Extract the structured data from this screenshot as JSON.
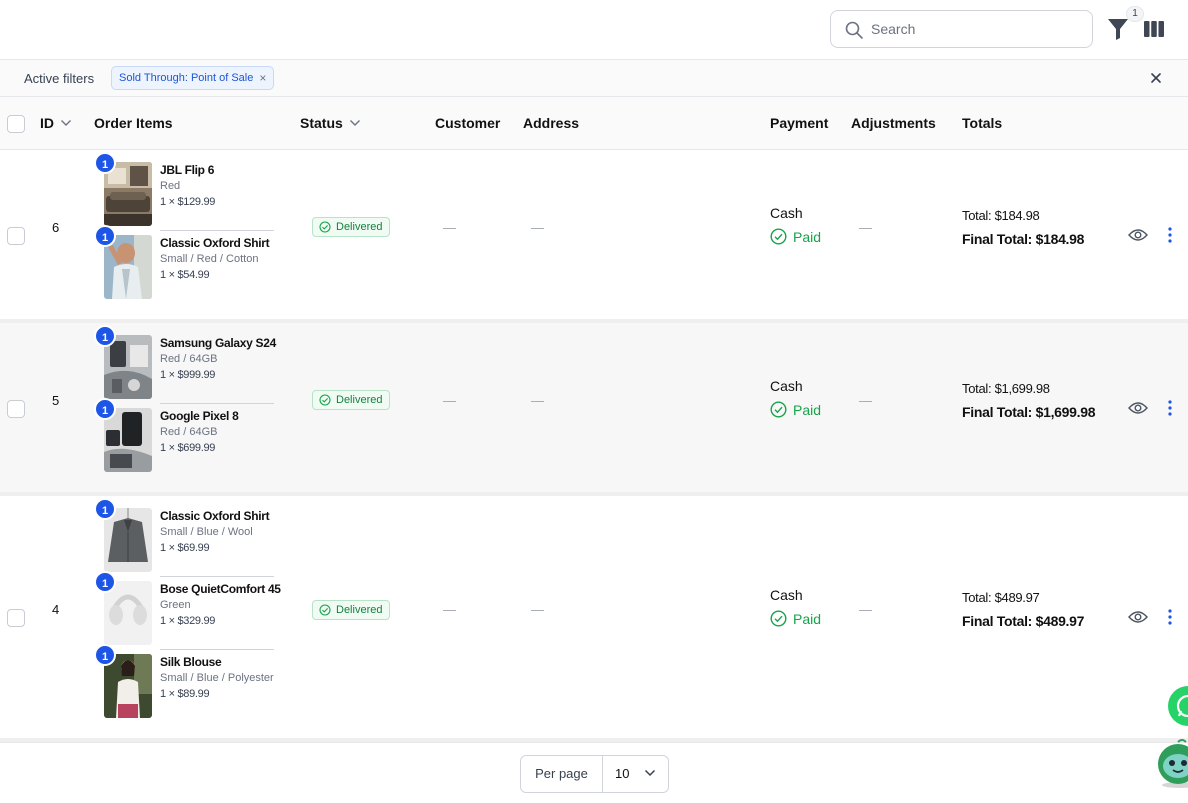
{
  "search": {
    "placeholder": "Search"
  },
  "toolbar": {
    "filter_count": "1"
  },
  "active_filters": {
    "label": "Active filters",
    "chips": [
      {
        "label": "Sold Through: Point of Sale"
      }
    ]
  },
  "columns": {
    "id": "ID",
    "order_items": "Order Items",
    "status": "Status",
    "customer": "Customer",
    "address": "Address",
    "payment": "Payment",
    "adjustments": "Adjustments",
    "totals": "Totals"
  },
  "orders": [
    {
      "id": "6",
      "items": [
        {
          "qty": "1",
          "name": "JBL Flip 6",
          "variant": "Red",
          "price": "1 × $129.99",
          "thumb": "living-room"
        },
        {
          "qty": "1",
          "name": "Classic Oxford Shirt",
          "variant": "Small / Red / Cotton",
          "price": "1 × $54.99",
          "thumb": "shirt-model"
        }
      ],
      "status": "Delivered",
      "customer": "—",
      "address": "—",
      "payment_method": "Cash",
      "payment_status": "Paid",
      "adjustments": "—",
      "total": "Total: $184.98",
      "final_total": "Final Total: $184.98"
    },
    {
      "id": "5",
      "items": [
        {
          "qty": "1",
          "name": "Samsung Galaxy S24",
          "variant": "Red / 64GB",
          "price": "1 × $999.99",
          "thumb": "phone-desk"
        },
        {
          "qty": "1",
          "name": "Google Pixel 8",
          "variant": "Red / 64GB",
          "price": "1 × $699.99",
          "thumb": "phone-dark"
        }
      ],
      "status": "Delivered",
      "customer": "—",
      "address": "—",
      "payment_method": "Cash",
      "payment_status": "Paid",
      "adjustments": "—",
      "total": "Total: $1,699.98",
      "final_total": "Final Total: $1,699.98"
    },
    {
      "id": "4",
      "items": [
        {
          "qty": "1",
          "name": "Classic Oxford Shirt",
          "variant": "Small / Blue / Wool",
          "price": "1 × $69.99",
          "thumb": "jacket"
        },
        {
          "qty": "1",
          "name": "Bose QuietComfort 45",
          "variant": "Green",
          "price": "1 × $329.99",
          "thumb": "headphones"
        },
        {
          "qty": "1",
          "name": "Silk Blouse",
          "variant": "Small / Blue / Polyester",
          "price": "1 × $89.99",
          "thumb": "blouse-model"
        }
      ],
      "status": "Delivered",
      "customer": "—",
      "address": "—",
      "payment_method": "Cash",
      "payment_status": "Paid",
      "adjustments": "—",
      "total": "Total: $489.97",
      "final_total": "Final Total: $489.97"
    }
  ],
  "pagination": {
    "per_page_label": "Per page",
    "per_page_value": "10"
  },
  "colors": {
    "accent": "#1d55e6",
    "success": "#16a34a",
    "whatsapp": "#25d366"
  }
}
